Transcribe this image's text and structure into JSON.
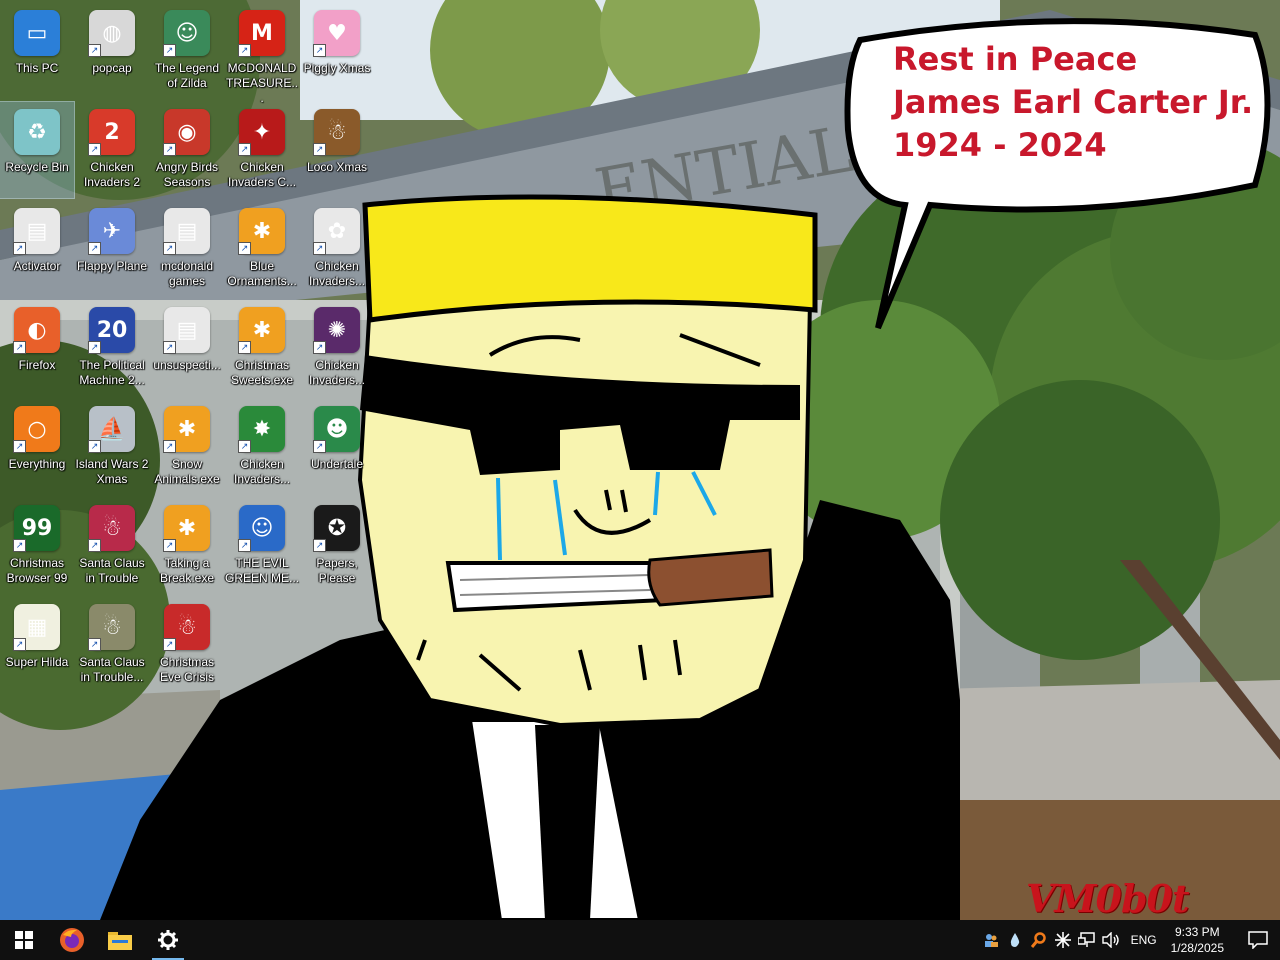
{
  "wallpaper": {
    "speech_bubble": {
      "line1": "Rest in Peace",
      "line2": "James Earl Carter Jr.",
      "line3": "1924 - 2024"
    },
    "building_sign": "ENTIAL",
    "watermark": "VM0b0t"
  },
  "desktop_icons": [
    {
      "label": "This PC",
      "icon": "this-pc-icon",
      "color": "#2b7fd8",
      "glyph": "▭",
      "selected": false
    },
    {
      "label": "popcap",
      "icon": "popcap-icon",
      "color": "#d8d8d8",
      "glyph": "◍",
      "selected": false
    },
    {
      "label": "The Legend of Zilda",
      "icon": "legend-of-zilda-icon",
      "color": "#3a8a5a",
      "glyph": "☺",
      "selected": false
    },
    {
      "label": "MCDONALD TREASURE...",
      "icon": "mcdonald-treasure-icon",
      "color": "#d62316",
      "glyph": "M",
      "selected": false
    },
    {
      "label": "Piggly Xmas",
      "icon": "piggly-xmas-icon",
      "color": "#f2a0c8",
      "glyph": "♥",
      "selected": false
    },
    {
      "label": "Recycle Bin",
      "icon": "recycle-bin-icon",
      "color": "#7ec4c8",
      "glyph": "♻",
      "selected": true
    },
    {
      "label": "Chicken Invaders 2",
      "icon": "chicken-invaders-2-icon",
      "color": "#d83a2a",
      "glyph": "2",
      "selected": false
    },
    {
      "label": "Angry Birds Seasons",
      "icon": "angry-birds-seasons-icon",
      "color": "#c8382a",
      "glyph": "◉",
      "selected": false
    },
    {
      "label": "Chicken Invaders C...",
      "icon": "chicken-invaders-c-icon",
      "color": "#b81a1a",
      "glyph": "✦",
      "selected": false
    },
    {
      "label": "Loco Xmas",
      "icon": "loco-xmas-icon",
      "color": "#8a5a2a",
      "glyph": "☃",
      "selected": false
    },
    {
      "label": "Activator",
      "icon": "activator-icon",
      "color": "#e8e8e8",
      "glyph": "▤",
      "selected": false
    },
    {
      "label": "Flappy Plane",
      "icon": "flappy-plane-icon",
      "color": "#6a8ad8",
      "glyph": "✈",
      "selected": false
    },
    {
      "label": "mcdonald games",
      "icon": "mcdonald-games-icon",
      "color": "#e8e8e8",
      "glyph": "▤",
      "selected": false
    },
    {
      "label": "Blue Ornaments...",
      "icon": "blue-ornaments-icon",
      "color": "#f0a020",
      "glyph": "✱",
      "selected": false
    },
    {
      "label": "Chicken Invaders...",
      "icon": "chicken-invaders-3-icon",
      "color": "#e8e8e8",
      "glyph": "✿",
      "selected": false
    },
    {
      "label": "Firefox",
      "icon": "firefox-icon",
      "color": "#e8602a",
      "glyph": "◐",
      "selected": false
    },
    {
      "label": "The Political Machine 2...",
      "icon": "political-machine-icon",
      "color": "#2a4aa8",
      "glyph": "20",
      "selected": false
    },
    {
      "label": "unsuspecti...",
      "icon": "unsuspecting-file-icon",
      "color": "#e8e8e8",
      "glyph": "▤",
      "selected": false
    },
    {
      "label": "Christmas Sweets.exe",
      "icon": "christmas-sweets-icon",
      "color": "#f0a020",
      "glyph": "✱",
      "selected": false
    },
    {
      "label": "Chicken Invaders...",
      "icon": "chicken-invaders-4-icon",
      "color": "#5a2a6a",
      "glyph": "✺",
      "selected": false
    },
    {
      "label": "Everything",
      "icon": "everything-search-icon",
      "color": "#f07a1a",
      "glyph": "○",
      "selected": false
    },
    {
      "label": "Island Wars 2 Xmas",
      "icon": "island-wars-icon",
      "color": "#b8c0c8",
      "glyph": "⛵",
      "selected": false
    },
    {
      "label": "Snow Animals.exe",
      "icon": "snow-animals-icon",
      "color": "#f0a020",
      "glyph": "✱",
      "selected": false
    },
    {
      "label": "Chicken Invaders...",
      "icon": "chicken-invaders-5-icon",
      "color": "#2a8a3a",
      "glyph": "✸",
      "selected": false
    },
    {
      "label": "Undertale",
      "icon": "undertale-icon",
      "color": "#2a8a4a",
      "glyph": "☻",
      "selected": false
    },
    {
      "label": "Christmas Browser 99",
      "icon": "christmas-browser-icon",
      "color": "#1a6a2a",
      "glyph": "99",
      "selected": false
    },
    {
      "label": "Santa Claus in Trouble",
      "icon": "santa-claus-trouble-icon",
      "color": "#b82a4a",
      "glyph": "☃",
      "selected": false
    },
    {
      "label": "Taking a Break.exe",
      "icon": "taking-a-break-icon",
      "color": "#f0a020",
      "glyph": "✱",
      "selected": false
    },
    {
      "label": "THE EVIL GREEN ME...",
      "icon": "evil-green-icon",
      "color": "#2a6ac8",
      "glyph": "☺",
      "selected": false
    },
    {
      "label": "Papers, Please",
      "icon": "papers-please-icon",
      "color": "#1a1a1a",
      "glyph": "✪",
      "selected": false
    },
    {
      "label": "Super Hilda",
      "icon": "super-hilda-icon",
      "color": "#f0f0e0",
      "glyph": "▦",
      "selected": false
    },
    {
      "label": "Santa Claus in Trouble...",
      "icon": "santa-claus-trouble-2-icon",
      "color": "#8a8a6a",
      "glyph": "☃",
      "selected": false
    },
    {
      "label": "Christmas Eve Crisis",
      "icon": "christmas-eve-crisis-icon",
      "color": "#c82a2a",
      "glyph": "☃",
      "selected": false
    }
  ],
  "taskbar": {
    "start": "windows-start-icon",
    "pinned": [
      {
        "name": "firefox-taskbar-button",
        "icon": "firefox-icon",
        "running": false
      },
      {
        "name": "file-explorer-taskbar-button",
        "icon": "folder-icon",
        "running": false
      },
      {
        "name": "settings-taskbar-button",
        "icon": "gear-icon",
        "running": true
      }
    ],
    "tray": {
      "language": "ENG",
      "time": "9:33 PM",
      "date": "1/28/2025"
    }
  },
  "colors": {
    "taskbar": "#101010",
    "bubble_text": "#c8182c",
    "watermark": "#c8141c",
    "hat_yellow": "#f8e81a",
    "face": "#f8f4b0"
  }
}
